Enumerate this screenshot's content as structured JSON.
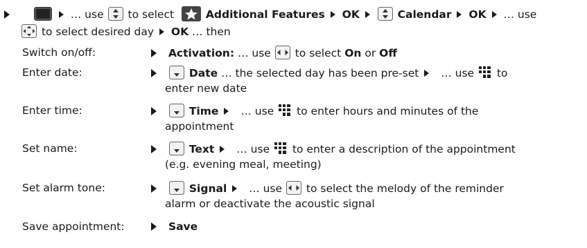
{
  "intro": {
    "use1": "… use",
    "to_select": "to select",
    "additional_features": "Additional Features",
    "ok1": "OK",
    "calendar": "Calendar",
    "ok2": "OK",
    "use2": "… use",
    "to_select_day": "to select desired day",
    "ok3": "OK",
    "then": "… then"
  },
  "rows": [
    {
      "label": "Switch on/off:"
    },
    {
      "label": "Enter date:"
    },
    {
      "label": "Enter time:"
    },
    {
      "label": "Set name:"
    },
    {
      "label": "Set alarm tone:"
    },
    {
      "label": "Save appointment:"
    }
  ],
  "activation": {
    "name": "Activation:",
    "use": "… use",
    "to_select": "to select",
    "on": "On",
    "or": "or",
    "off": "Off"
  },
  "date": {
    "name": "Date",
    "preset": "… the selected day has been pre-set",
    "use": "… use",
    "to": "to",
    "cont": "enter new date"
  },
  "time": {
    "name": "Time",
    "use": "… use",
    "text": "to enter hours and minutes of the",
    "cont": "appointment"
  },
  "text_row": {
    "name": "Text",
    "use": "… use",
    "text": "to enter a description of the appointment",
    "cont": "(e.g. evening meal, meeting)"
  },
  "signal": {
    "name": "Signal",
    "use": "… use",
    "text": "to select the melody of the reminder",
    "cont": "alarm or deactivate the acoustic signal"
  },
  "save": {
    "name": "Save"
  },
  "icons": [
    "menu-key-icon",
    "nav-key-up-down-icon",
    "star-icon",
    "nav-key-icon",
    "nav-key-left-right-icon",
    "nav-key-down-icon",
    "keypad-icon"
  ]
}
